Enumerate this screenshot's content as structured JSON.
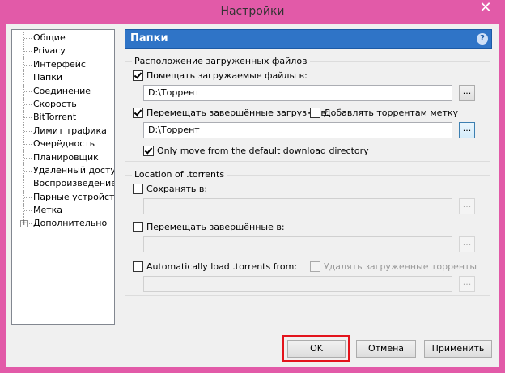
{
  "window": {
    "title": "Настройки",
    "close_glyph": "✕"
  },
  "tree": {
    "items": [
      {
        "label": "Общие"
      },
      {
        "label": "Privacy"
      },
      {
        "label": "Интерфейс"
      },
      {
        "label": "Папки",
        "selected": true
      },
      {
        "label": "Соединение"
      },
      {
        "label": "Скорость"
      },
      {
        "label": "BitTorrent"
      },
      {
        "label": "Лимит трафика"
      },
      {
        "label": "Очерёдность"
      },
      {
        "label": "Планировщик"
      },
      {
        "label": "Удалённый доступ"
      },
      {
        "label": "Воспроизведение"
      },
      {
        "label": "Парные устройства"
      },
      {
        "label": "Метка"
      },
      {
        "label": "Дополнительно",
        "expandable": true
      }
    ],
    "expander_glyph": "+"
  },
  "panel": {
    "title": "Папки",
    "help_glyph": "?",
    "downloads_group": {
      "title": "Расположение загруженных файлов",
      "put_new_label": "Помещать загружаемые файлы в:",
      "put_new_checked": true,
      "put_new_path": "D:\\Торрент",
      "move_completed_label": "Перемещать завершённые загрузки в:",
      "move_completed_checked": true,
      "append_label_label": "Добавлять торрентам метку",
      "append_label_checked": false,
      "move_completed_path": "D:\\Торрент",
      "only_move_label": "Only move from the default download directory",
      "only_move_checked": true
    },
    "torrents_group": {
      "title": "Location of .torrents",
      "store_label": "Сохранять в:",
      "store_checked": false,
      "store_path": "",
      "move_completed_label": "Перемещать завершённые в:",
      "move_completed_checked": false,
      "move_completed_path": "",
      "autoload_label": "Automatically load .torrents from:",
      "autoload_checked": false,
      "delete_loaded_label": "Удалять загруженные торренты",
      "delete_loaded_checked": false,
      "autoload_path": ""
    },
    "browse_label": "..."
  },
  "buttons": {
    "ok": "OK",
    "cancel": "Отмена",
    "apply": "Применить"
  },
  "colors": {
    "frame": "#e25aa8",
    "header": "#2f74c7",
    "ok_highlight": "#e3141c"
  }
}
